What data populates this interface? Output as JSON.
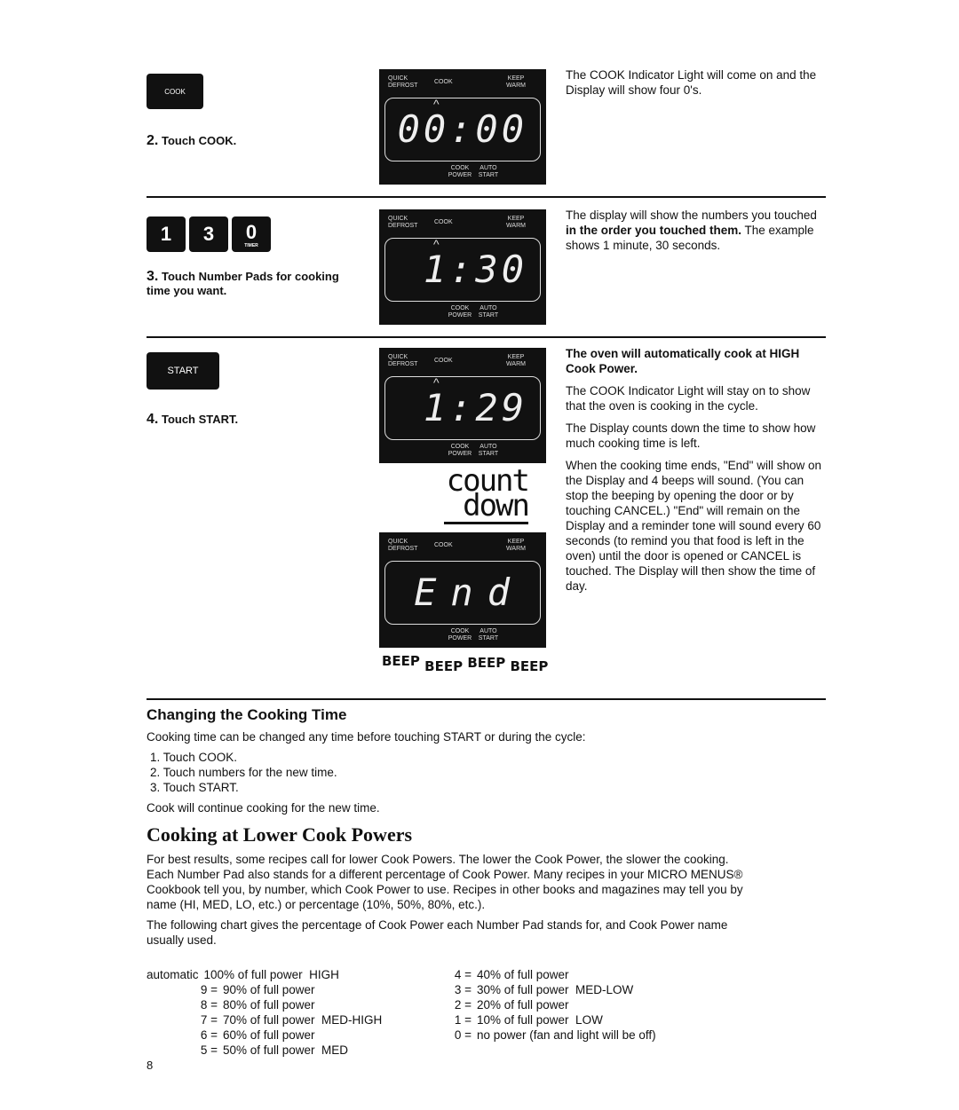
{
  "steps": [
    {
      "pads": [
        "COOK"
      ],
      "num": "2.",
      "label": "Touch COOK.",
      "display": "00:00",
      "text": [
        {
          "plain": "The COOK Indicator Light will come on and the Display will show four 0's."
        }
      ]
    },
    {
      "pads": [
        "1",
        "3",
        "0"
      ],
      "pad_sub": "TIMER",
      "num": "3.",
      "label": "Touch Number Pads for cooking time you want.",
      "display": "1:30",
      "text": [
        {
          "plain": "The display will show the numbers you touched ",
          "bold": "in the order you touched them.",
          "after": " The example shows 1 minute, 30 seconds."
        }
      ]
    },
    {
      "pads": [
        "START"
      ],
      "num": "4.",
      "label": "Touch START.",
      "display": "1:29",
      "text": [
        {
          "bold": "The oven will automatically cook at HIGH Cook Power."
        },
        {
          "plain": "The COOK Indicator Light will stay on to show that the oven is cooking in the cycle."
        },
        {
          "plain": "The Display counts down the time to show how much cooking time is left."
        },
        {
          "plain": "When the cooking time ends, \"End\" will show on the Display and 4 beeps will sound. (You can stop the beeping by opening the door or by touching CANCEL.) \"End\" will remain on the Display and a reminder tone will sound every 60 seconds (to remind you that food is left in the oven) until the door is opened or CANCEL is touched. The Display will then show the time of day."
        }
      ]
    }
  ],
  "display_labels": {
    "quick_defrost": "QUICK DEFROST",
    "cook": "COOK",
    "keep_warm": "KEEP WARM",
    "cook_power": "COOK POWER",
    "auto_start": "AUTO START"
  },
  "countdown": {
    "line1": "count",
    "line2": "down"
  },
  "end_display": "End",
  "beeps": [
    "BEEP",
    "BEEP",
    "BEEP",
    "BEEP"
  ],
  "changing": {
    "heading": "Changing the Cooking Time",
    "intro": "Cooking time can be changed any time before touching START or during the cycle:",
    "list": [
      "1. Touch COOK.",
      "2. Touch numbers for the new time.",
      "3. Touch START."
    ],
    "outro": "Cook will continue cooking for the new time."
  },
  "lower": {
    "heading": "Cooking at Lower Cook Powers",
    "p1": "For best results, some recipes call for lower Cook Powers. The lower the Cook Power, the slower the cooking. Each Number Pad also stands for a different percentage of Cook Power. Many recipes in your MICRO MENUS® Cookbook tell you, by number, which Cook Power to use. Recipes in other books and magazines may tell you by name (HI, MED, LO, etc.) or percentage (10%, 50%, 80%, etc.).",
    "p2": "The following chart gives the percentage of Cook Power each Number Pad stands for, and Cook Power name usually used.",
    "left": [
      {
        "k": "automatic",
        "v": "100% of full power  HIGH"
      },
      {
        "k": "9 =",
        "v": "90% of full power"
      },
      {
        "k": "8 =",
        "v": "80% of full power"
      },
      {
        "k": "7 =",
        "v": "70% of full power  MED-HIGH"
      },
      {
        "k": "6 =",
        "v": "60% of full power"
      },
      {
        "k": "5 =",
        "v": "50% of full power  MED"
      }
    ],
    "right": [
      {
        "k": "4 =",
        "v": "40% of full power"
      },
      {
        "k": "3 =",
        "v": "30% of full power  MED-LOW"
      },
      {
        "k": "2 =",
        "v": "20% of full power"
      },
      {
        "k": "1 =",
        "v": "10% of full power  LOW"
      },
      {
        "k": "0 =",
        "v": "no power (fan and light will be off)"
      }
    ]
  },
  "page_number": "8"
}
